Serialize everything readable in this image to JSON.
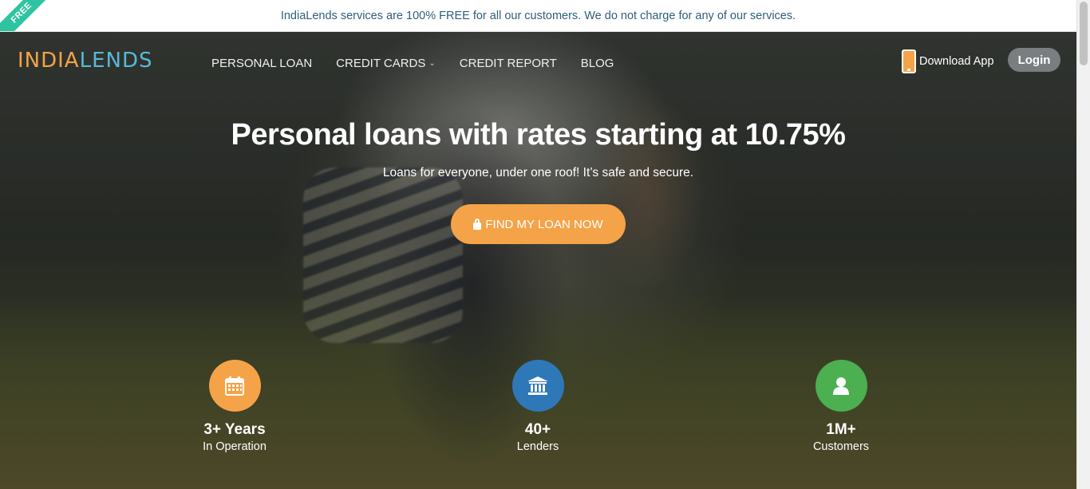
{
  "topbar": {
    "ribbon": "FREE",
    "message": "IndiaLends services are 100% FREE for all our customers. We do not charge for any of our services."
  },
  "header": {
    "logo": {
      "part1": "INDIA",
      "part2": "LENDS",
      "colors": [
        "#f5a348",
        "#59b8d8"
      ]
    },
    "nav": [
      {
        "label": "PERSONAL LOAN"
      },
      {
        "label": "CREDIT CARDS",
        "has_dropdown": true
      },
      {
        "label": "CREDIT REPORT"
      },
      {
        "label": "BLOG"
      }
    ],
    "download_app": "Download App",
    "login": "Login"
  },
  "hero": {
    "headline": "Personal loans with rates starting at 10.75%",
    "subline": "Loans for everyone, under one roof! It’s safe and secure.",
    "cta": "FIND MY LOAN NOW"
  },
  "stats": [
    {
      "value": "3+ Years",
      "label": "In Operation",
      "icon": "calendar-icon",
      "color": "#f5a348"
    },
    {
      "value": "40+",
      "label": "Lenders",
      "icon": "bank-icon",
      "color": "#2e78b8"
    },
    {
      "value": "1M+",
      "label": "Customers",
      "icon": "user-icon",
      "color": "#4caf50"
    }
  ]
}
